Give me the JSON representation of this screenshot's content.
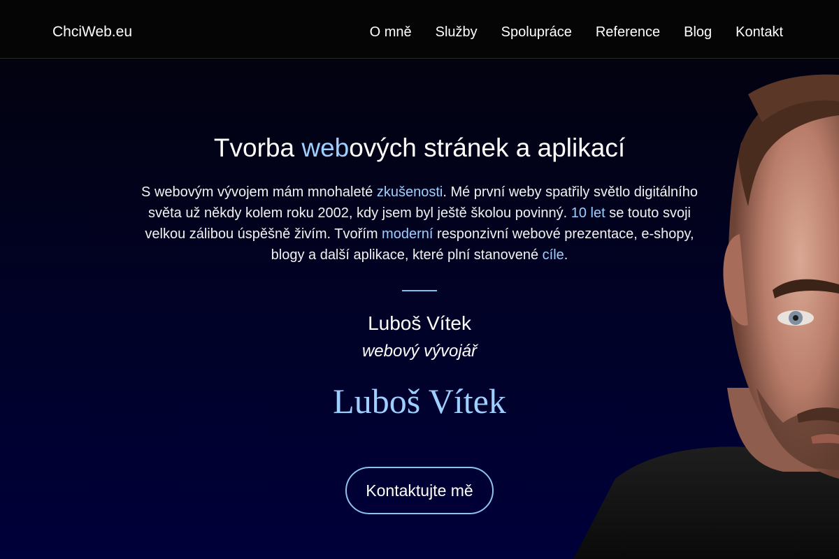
{
  "header": {
    "brand": "ChciWeb.eu",
    "nav": [
      "O mně",
      "Služby",
      "Spolupráce",
      "Reference",
      "Blog",
      "Kontakt"
    ]
  },
  "hero": {
    "title_before": "Tvorba ",
    "title_highlight": "web",
    "title_after": "ových stránek a aplikací",
    "intro": {
      "p1": "S webovým vývojem mám mnohaleté ",
      "link_experience": "zkušenosti",
      "p2": ". Mé první weby spatřily světlo digitálního světa už někdy kolem roku 2002, kdy jsem byl ještě školou povinný. ",
      "link_years": "10 let",
      "p3": " se touto svoji velkou zálibou úspěšně živím. Tvořím ",
      "link_modern": "moderní",
      "p4": " responzivní webové prezentace, e-shopy, blogy a další aplikace, které plní stanovené ",
      "link_goals": "cíle",
      "p5": "."
    },
    "name": "Luboš Vítek",
    "role": "webový vývojář",
    "signature": "Luboš Vítek",
    "cta_label": "Kontaktujte mě"
  },
  "colors": {
    "accent": "#9ecfff",
    "background_top": "#020210",
    "background_bottom": "#00003a",
    "navbar": "#050505"
  }
}
